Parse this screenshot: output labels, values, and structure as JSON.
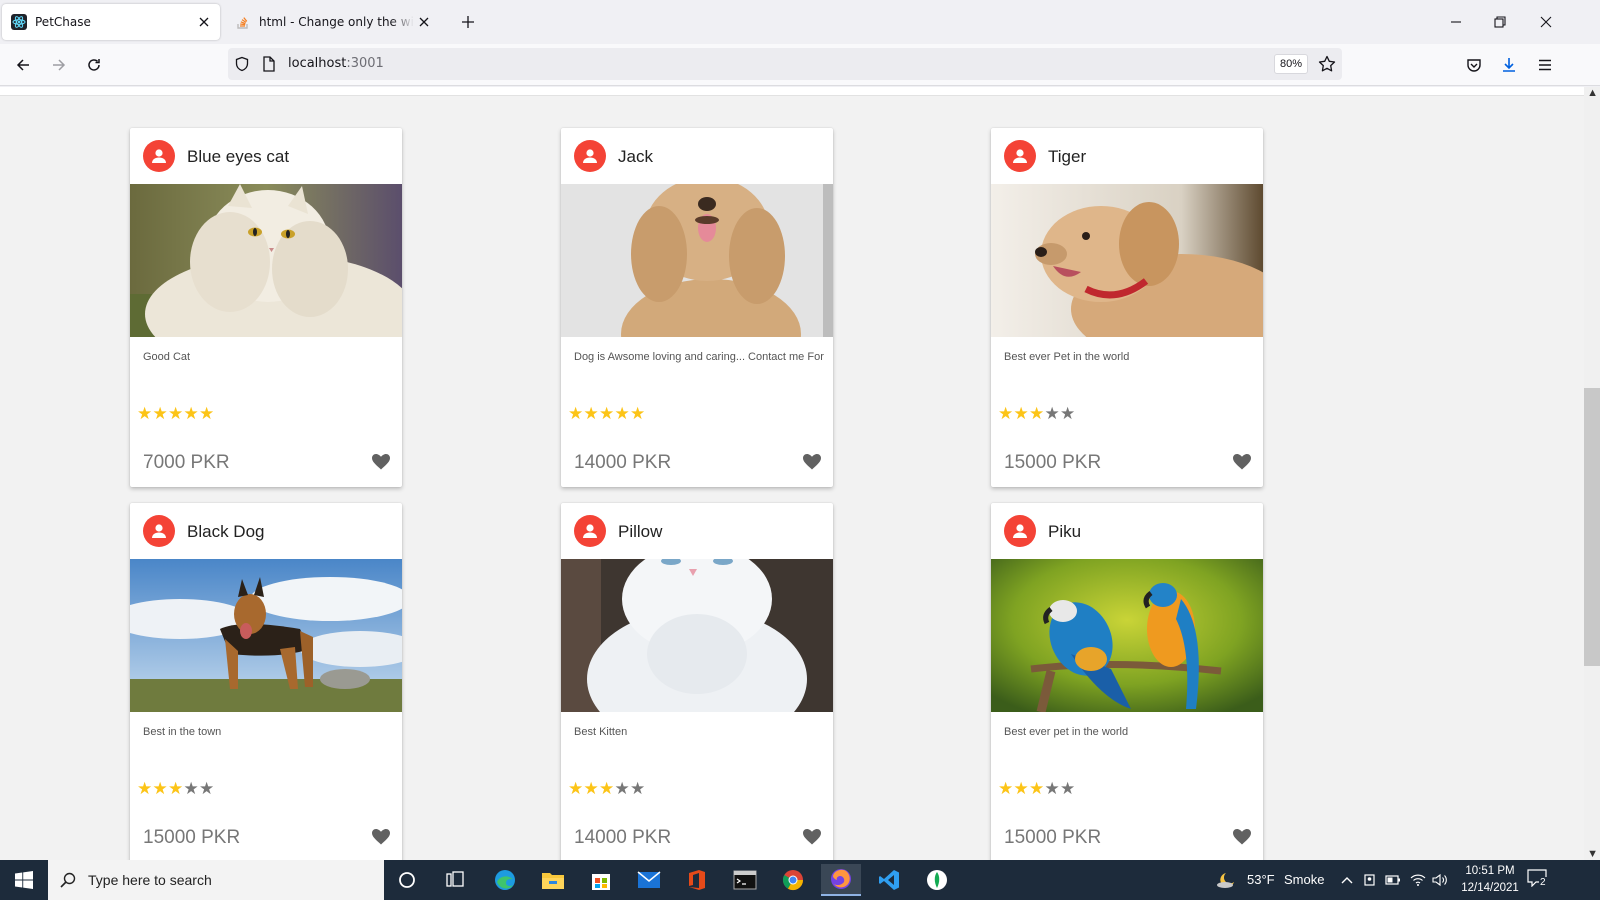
{
  "browser": {
    "tabs": [
      {
        "title": "PetChase",
        "favicon": "react-icon",
        "active": true
      },
      {
        "title": "html - Change only the width of",
        "favicon": "stackoverflow-icon",
        "active": false
      }
    ],
    "url_host": "localhost",
    "url_port": ":3001",
    "zoom": "80%"
  },
  "cards": [
    {
      "title": "Blue eyes cat",
      "description": "Good Cat",
      "rating": 5,
      "price": "7000 PKR",
      "image": "white-persian-cat"
    },
    {
      "title": "Jack",
      "description": "Dog is Awsome loving and caring... Contact me For",
      "rating": 5,
      "price": "14000 PKR",
      "image": "fluffy-puppy"
    },
    {
      "title": "Tiger",
      "description": "Best ever Pet in the world",
      "rating": 3,
      "price": "15000 PKR",
      "image": "golden-retriever-puppy"
    },
    {
      "title": "Black Dog",
      "description": "Best in the town",
      "rating": 3,
      "price": "15000 PKR",
      "image": "german-shepherd"
    },
    {
      "title": "Pillow",
      "description": "Best Kitten",
      "rating": 3,
      "price": "14000 PKR",
      "image": "white-kitten"
    },
    {
      "title": "Piku",
      "description": "Best ever pet in the world",
      "rating": 3,
      "price": "15000 PKR",
      "image": "macaw-parrots"
    }
  ],
  "rating_max": 5,
  "colors": {
    "avatar": "#f44336",
    "star_on": "#fcc417",
    "star_off": "#777777",
    "taskbar": "#1d2b3b"
  },
  "taskbar": {
    "search_placeholder": "Type here to search",
    "weather_temp": "53°F",
    "weather_text": "Smoke",
    "time": "10:51 PM",
    "date": "12/14/2021",
    "notification_count": "2",
    "pinned_apps": [
      "cortana-icon",
      "task-view-icon",
      "edge-icon",
      "file-explorer-icon",
      "store-icon",
      "mail-icon",
      "office-icon",
      "terminal-icon",
      "chrome-icon",
      "firefox-icon",
      "vscode-icon",
      "mongodb-compass-icon"
    ]
  }
}
